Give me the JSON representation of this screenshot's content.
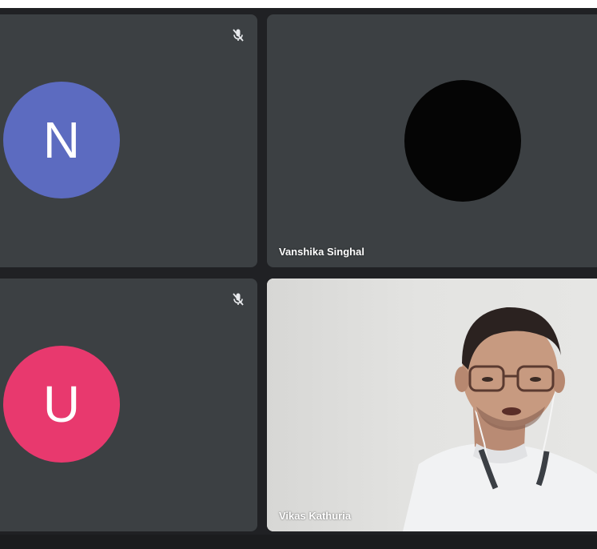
{
  "participants": [
    {
      "initial": "N",
      "muted": true,
      "avatar_color": "#5c6bc0"
    },
    {
      "name": "Vanshika Singhal",
      "muted": false,
      "avatar_color": "#050505"
    },
    {
      "initial": "U",
      "muted": true,
      "avatar_color": "#e8396e"
    },
    {
      "name": "Vikas Kathuria",
      "muted": false,
      "video": true
    }
  ],
  "icons": {
    "muted": "mic-off-icon"
  }
}
